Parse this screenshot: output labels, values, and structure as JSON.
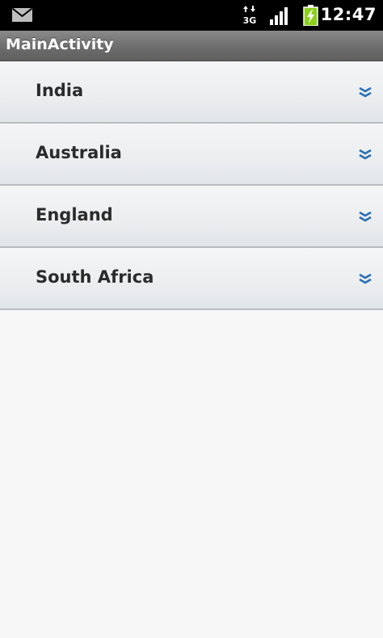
{
  "status_bar": {
    "time": "12:47",
    "data_indicator": "3G",
    "icons": [
      "mail-icon",
      "data-3g-icon",
      "signal-icon",
      "battery-charging-icon"
    ]
  },
  "action_bar": {
    "title": "MainActivity"
  },
  "list": {
    "groups": [
      {
        "label": "India",
        "icon": "chevron-double-down-icon"
      },
      {
        "label": "Australia",
        "icon": "chevron-double-down-icon"
      },
      {
        "label": "England",
        "icon": "chevron-double-down-icon"
      },
      {
        "label": "South Africa",
        "icon": "chevron-double-down-icon"
      }
    ]
  },
  "colors": {
    "status_bar_bg": "#000000",
    "title_bar_bg": "#6d6d6d",
    "row_bg": "#eceef0",
    "row_divider": "#b9bcc0",
    "label_text": "#2b2b2b",
    "icon_blue": "#2a6fb3",
    "battery_green": "#8ccf1c",
    "page_bg": "#f7f7f7"
  }
}
